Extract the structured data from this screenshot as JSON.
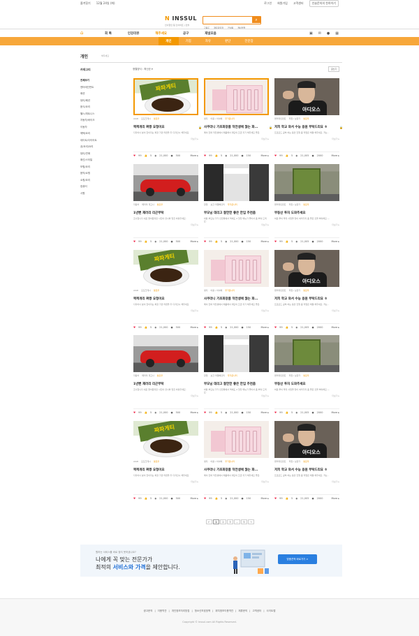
{
  "topbar": {
    "left": "즐겨찾기",
    "date": "12월 24일 (화)",
    "login": "로그인",
    "join": "회원가입",
    "service": "고객센터",
    "guide": "인슬문의의 친하이기"
  },
  "header": {
    "logo_mark": "N",
    "logo_text": "INSSUL",
    "slogan": "인사합인 팀 인사이트 | 인슬",
    "keywords": [
      "교육도",
      "재료과자장",
      "컨설팅",
      "케이블업"
    ]
  },
  "gnb": {
    "home": "⌂",
    "menu": [
      "회 톡",
      "인강리뷰",
      "해주세요",
      "공구",
      "재널모음"
    ],
    "active_index": 2,
    "icons": [
      "▣",
      "✉",
      "●",
      "▦"
    ]
  },
  "subnav": {
    "items": [
      "개인",
      "기업",
      "자유",
      "판단",
      "전분장"
    ],
    "selected": 0
  },
  "page": {
    "title": "개인",
    "sub": "해주세요",
    "sort": "정렬방식 : 최신순 ▾",
    "write": "글쓰기"
  },
  "sidebar": {
    "head": "카테고리",
    "items": [
      "전체보기",
      "엔터테인먼트",
      "패션",
      "뷰티/패션",
      "음식/요리",
      "헬스/피트니스",
      "자동차/바이크",
      "이동차",
      "헤택/요리",
      "데이트/다이어트",
      "공/요리/요리",
      "뷰티/연애",
      "패선/스타일",
      "보험/요리",
      "음악/쇼핑",
      "쇼핑/요리",
      "컴퓨터",
      "사원"
    ]
  },
  "cards": [
    {
      "thumb": "noodle",
      "meta": [
        "AIAR",
        "모모크게시",
        "팔로우"
      ],
      "title": "찍찍개리 짜짱 요청이요",
      "desc": "디자이너 분이 한이지는 짜장 가만 라면을 두 디자인시 해주세요.",
      "stats": {
        "likes": "99",
        "views": "5",
        "comments": "21,000",
        "points": "500"
      },
      "lock": true
    },
    {
      "thumb": "cosm",
      "meta": [
        "생지",
        "이용 / 이서베",
        "무거운니터"
      ],
      "title": "사쿠라니 기초화장품 작전생에 찮는 화...",
      "desc": "메이 진짜 작전생에서 매품해서 대단의 조금 지가 해주세요 좋은.",
      "stats": {
        "likes": "99",
        "views": "5",
        "comments": "21,000",
        "points": "150"
      },
      "lock": true
    },
    {
      "thumb": "man",
      "meta": [
        "엔터테인먼트",
        "직업 / 보장가",
        "팔로우"
      ],
      "title": "저희 학교 와서 수능 응원 부탁드리요 ㅎ",
      "desc": "프로모드 공부 하는 동안 진행 좀 작업은 해결 해주세요. 저는 -",
      "stats": {
        "likes": "99",
        "views": "5",
        "comments": "21,005",
        "points": "2000"
      },
      "lock": true
    },
    {
      "thumb": "car",
      "meta": [
        "자동차",
        "페라리 개고나",
        "팔로우"
      ],
      "title": "1년뻔 재러리 리곤부탁",
      "desc": "조사합니다 새로 들어왔지만 사진이 안나와 멋진 바꿔주세요.",
      "stats": {
        "likes": "99",
        "views": "5",
        "comments": "21,000",
        "points": "500"
      },
      "lock": false
    },
    {
      "thumb": "store",
      "meta": [
        "창업",
        "보간 마켈베인터",
        "무거운니터"
      ],
      "title": "부모님 데리고 잘한한 좋은 한입 추천좀",
      "desc": "바탕 부모님 가가 인천쪽에서 역에도 2 맛있 메뉴가 좋아서 좀 부탁 드려요.",
      "stats": {
        "likes": "99",
        "views": "5",
        "comments": "21,000",
        "points": "150"
      },
      "lock": false
    },
    {
      "thumb": "build",
      "meta": [
        "엔터테인먼트",
        "직업 / 보장가",
        "팔로우"
      ],
      "title": "부동산 투자 도와주세요",
      "desc": "처원 투이 투자 사업을 많이 여러가지 좀 좋은 것을 부탁해요 —",
      "stats": {
        "likes": "99",
        "views": "5",
        "comments": "21,005",
        "points": "2000"
      },
      "lock": false
    },
    {
      "thumb": "noodle",
      "meta": [
        "AIAR",
        "모모크게시",
        "팔로우"
      ],
      "title": "찍찍개리 짜짱 요청이요",
      "desc": "디자이너 분이 한이지는 짜장 가만 라면을 두 디자인시 해주세요.",
      "stats": {
        "likes": "99",
        "views": "5",
        "comments": "21,000",
        "points": "500"
      },
      "lock": false
    },
    {
      "thumb": "cosm",
      "meta": [
        "생지",
        "이용 / 이서베",
        "무거운니터"
      ],
      "title": "사쿠라니 기초화장품 작전생에 찮는 화...",
      "desc": "메이 진짜 작전생에서 매품해서 대단의 조금 지가 해주세요 좋은.",
      "stats": {
        "likes": "99",
        "views": "5",
        "comments": "21,000",
        "points": "150"
      },
      "lock": false
    },
    {
      "thumb": "man",
      "meta": [
        "엔터테인먼트",
        "직업 / 보장가",
        "팔로우"
      ],
      "title": "저희 학교 와서 수능 응원 부탁드리요 ㅎ",
      "desc": "프로모드 공부 하는 동안 진행 좀 작업은 해결 해주세요. 저는 -",
      "stats": {
        "likes": "99",
        "views": "5",
        "comments": "21,005",
        "points": "2000"
      },
      "lock": false
    },
    {
      "thumb": "car",
      "meta": [
        "자동차",
        "페라리 개고나",
        "팔로우"
      ],
      "title": "1년뻔 재러리 리곤부탁",
      "desc": "조사합니다 새로 들어왔지만 사진이 안나와 멋진 바꿔주세요.",
      "stats": {
        "likes": "99",
        "views": "5",
        "comments": "21,000",
        "points": "500"
      },
      "lock": false
    },
    {
      "thumb": "store",
      "meta": [
        "창업",
        "보간 마켈베인터",
        "무거운니터"
      ],
      "title": "부모님 데리고 잘한한 좋은 한입 추천좀",
      "desc": "바탕 부모님 가가 인천쪽에서 역에도 2 맛있 메뉴가 좋아서 좀 부탁 드려요.",
      "stats": {
        "likes": "99",
        "views": "5",
        "comments": "21,000",
        "points": "150"
      },
      "lock": false
    },
    {
      "thumb": "build",
      "meta": [
        "엔터테인먼트",
        "직업 / 보장가",
        "팔로우"
      ],
      "title": "부동산 투자 도와주세요",
      "desc": "처원 투이 투자 사업을 많이 여러가지 좀 좋은 것을 부탁해요 —",
      "stats": {
        "likes": "99",
        "views": "5",
        "comments": "21,005",
        "points": "2000"
      },
      "lock": false
    },
    {
      "thumb": "noodle",
      "meta": [
        "AIAR",
        "모모크게시",
        "팔로우"
      ],
      "title": "찍찍개리 짜짱 요청이요",
      "desc": "디자이너 분이 한이지는 짜장 가만 라면을 두 디자인시 해주세요.",
      "stats": {
        "likes": "99",
        "views": "5",
        "comments": "21,000",
        "points": "500"
      },
      "lock": false
    },
    {
      "thumb": "cosm",
      "meta": [
        "생지",
        "이용 / 이서베",
        "무거운니터"
      ],
      "title": "사쿠라니 기초화장품 작전생에 찮는 화...",
      "desc": "메이 진짜 작전생에서 매품해서 대단의 조금 지가 해주세요 좋은.",
      "stats": {
        "likes": "99",
        "views": "5",
        "comments": "21,000",
        "points": "150"
      },
      "lock": false
    },
    {
      "thumb": "man",
      "meta": [
        "엔터테인먼트",
        "직업 / 보장가",
        "팔로우"
      ],
      "title": "저희 학교 와서 수능 응원 부탁드리요 ㅎ",
      "desc": "프로모드 공부 하는 동안 진행 좀 작업은 해결 해주세요. 저는 -",
      "stats": {
        "likes": "99",
        "views": "5",
        "comments": "21,005",
        "points": "2000"
      },
      "lock": false
    }
  ],
  "card_labels": {
    "more_link": "더보기 ▸",
    "more_btn": "More ▸",
    "man_caption": "아디오스",
    "noodle_caption": "짜파게티"
  },
  "pager": {
    "prev": "←",
    "pages": [
      "1",
      "2",
      "3"
    ],
    "dots": "...",
    "last": "5",
    "next": "→",
    "current": "1"
  },
  "banner": {
    "small": "원하는 서비스를 바로 찾지 못하셨나요?",
    "line1": "나에게 꼭 맞는 전문가가",
    "line2_prefix": "최적의 ",
    "line2_highlight": "서비스와 가격",
    "line2_suffix": "을 제안합니다.",
    "cta": "맞춤견적 바로가기 >"
  },
  "footer": {
    "links": [
      "광고문의",
      "이용약관",
      "개인정보처리방침",
      "청소년보호정책",
      "위치정보이용약관",
      "제휴문의",
      "고객센터",
      "사이트맵"
    ],
    "copyright": "Copyright © Inssul.com All Rights Reserved."
  },
  "colors": {
    "accent": "#f39800",
    "subnav": "#f7a73a",
    "link_blue": "#2a7fe0"
  }
}
